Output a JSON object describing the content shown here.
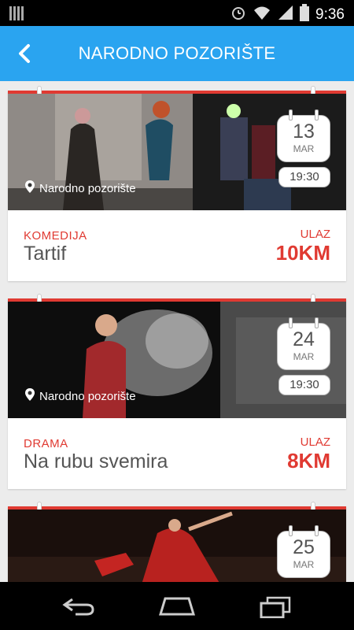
{
  "status_bar": {
    "time": "9:36",
    "icons": [
      "signal-bars-icon",
      "alarm-icon",
      "wifi-icon",
      "cell-signal-icon",
      "battery-icon"
    ]
  },
  "app_bar": {
    "title": "NARODNO POZORIŠTE",
    "back_icon": "back-arrow-icon"
  },
  "colors": {
    "accent": "#2aa4f0",
    "red": "#e03a32",
    "background": "#ececec"
  },
  "events": [
    {
      "day": "13",
      "month": "MAR",
      "time": "19:30",
      "location": "Narodno pozorište",
      "genre": "KOMEDIJA",
      "title": "Tartif",
      "price_label": "ULAZ",
      "price": "10KM"
    },
    {
      "day": "24",
      "month": "MAR",
      "time": "19:30",
      "location": "Narodno pozorište",
      "genre": "DRAMA",
      "title": "Na rubu svemira",
      "price_label": "ULAZ",
      "price": "8KM"
    },
    {
      "day": "25",
      "month": "MAR"
    }
  ],
  "nav_bar": {
    "icons": [
      "back-nav-icon",
      "home-nav-icon",
      "recents-nav-icon"
    ]
  }
}
